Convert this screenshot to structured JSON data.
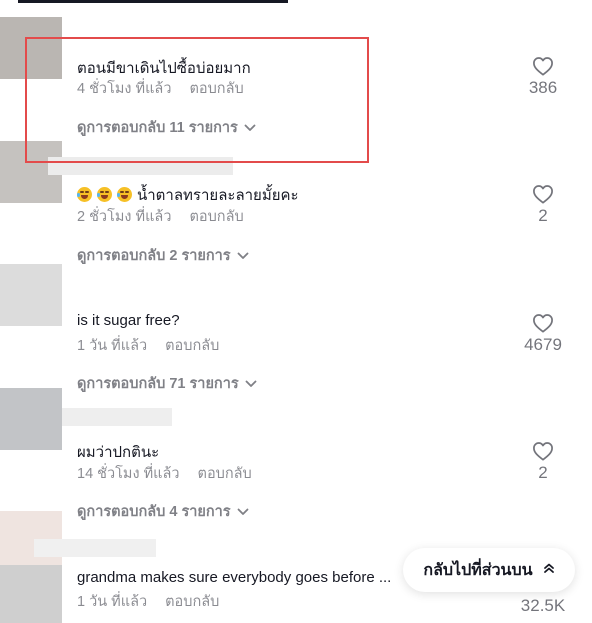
{
  "reply_label": "ตอบกลับ",
  "comments": [
    {
      "text": "ตอนมีขาเดินไปซื้อบ่อยมาก",
      "time": "4 ชั่วโมง ที่แล้ว",
      "view_replies": "ดูการตอบกลับ 11 รายการ",
      "likes": "386"
    },
    {
      "text": "น้ำตาลทรายละลายมั้ยคะ",
      "time": "2 ชั่วโมง ที่แล้ว",
      "view_replies": "ดูการตอบกลับ 2 รายการ",
      "likes": "2"
    },
    {
      "text": "is it sugar free?",
      "time": "1 วัน ที่แล้ว",
      "view_replies": "ดูการตอบกลับ 71 รายการ",
      "likes": "4679"
    },
    {
      "text": "ผมว่าปกตินะ",
      "time": "14 ชั่วโมง ที่แล้ว",
      "view_replies": "ดูการตอบกลับ 4 รายการ",
      "likes": "2"
    },
    {
      "text": "grandma makes sure everybody goes before ...",
      "time": "1 วัน ที่แล้ว",
      "likes": "32.5K"
    }
  ],
  "back_to_top": "กลับไปที่ส่วนบน",
  "colors": {
    "highlight": "#e34b4b",
    "text": "#161823"
  },
  "icons": [
    "heart-outline-icon",
    "chevron-down-icon",
    "double-chevron-up-icon",
    "laughing-crying-emoji"
  ]
}
